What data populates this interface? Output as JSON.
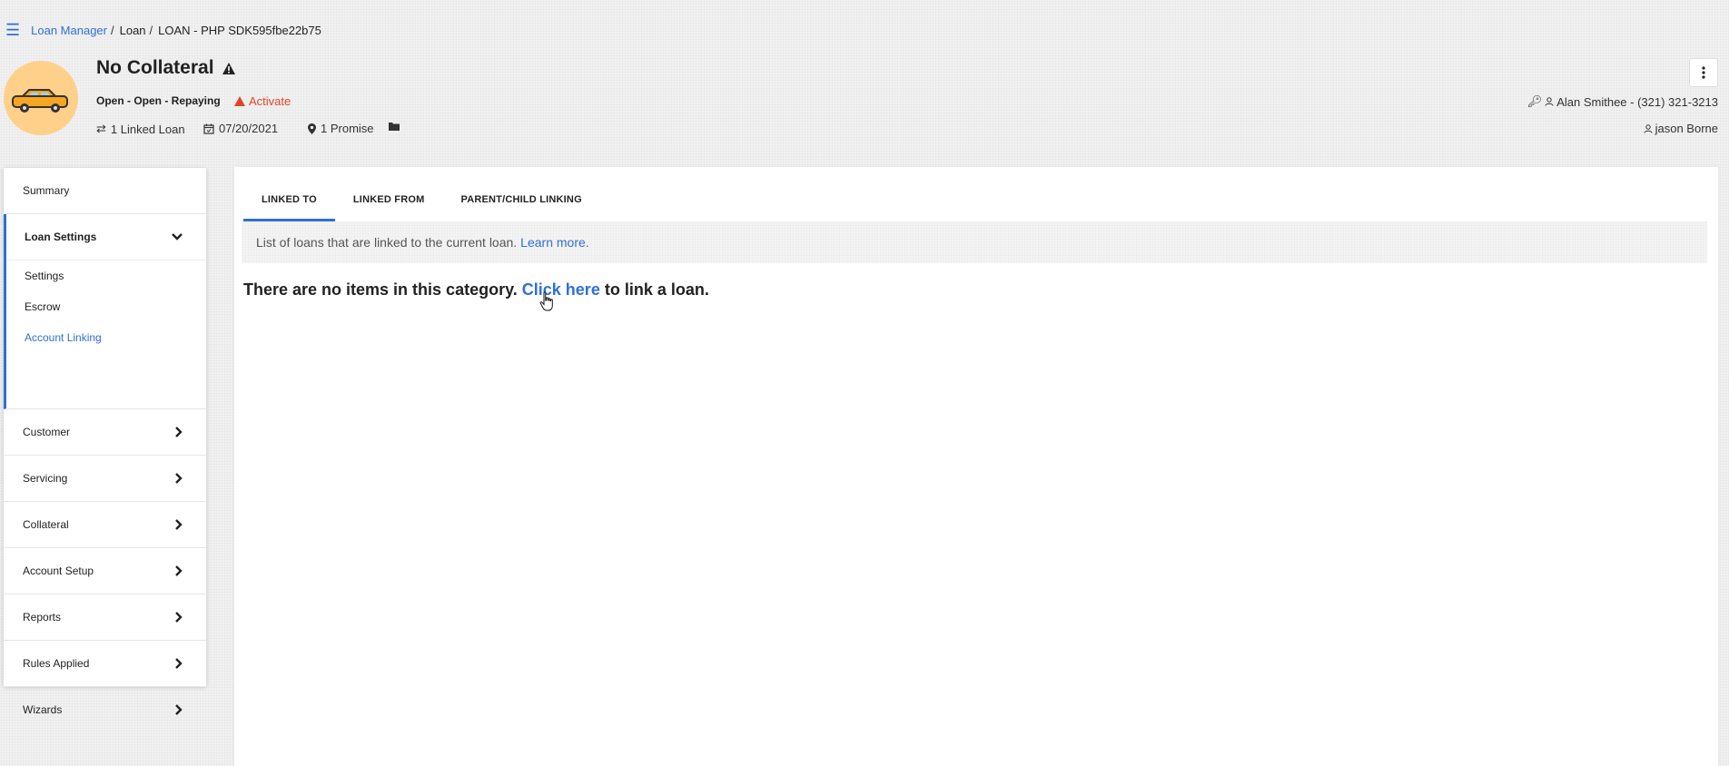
{
  "breadcrumb": {
    "menu_icon": "hamburger-menu-icon",
    "items": [
      "Loan Manager",
      "Loan",
      "LOAN - PHP SDK595fbe22b75"
    ],
    "separator": "/"
  },
  "header": {
    "title": "No Collateral",
    "status": "Open - Open - Repaying",
    "activate_label": "Activate",
    "linked_loan": "1 Linked Loan",
    "date": "07/20/2021",
    "promise": "1 Promise",
    "contact": "Alan Smithee - (321) 321-3213",
    "assignee": "jason Borne"
  },
  "sidebar": {
    "summary": "Summary",
    "loan_settings": {
      "label": "Loan Settings",
      "subitems": [
        "Settings",
        "Escrow",
        "Account Linking"
      ]
    },
    "items": [
      "Customer",
      "Servicing",
      "Collateral",
      "Account Setup",
      "Reports",
      "Rules Applied",
      "Wizards"
    ]
  },
  "tabs": [
    "LINKED TO",
    "LINKED FROM",
    "PARENT/CHILD LINKING"
  ],
  "info": {
    "text": "List of loans that are linked to the current loan.",
    "link": "Learn more."
  },
  "empty_state": {
    "prefix": "There are no items in this category.",
    "link": "Click here",
    "suffix": "to link a loan."
  },
  "colors": {
    "accent": "#2f6fd8",
    "warning": "#e0452b",
    "avatar_bg": "#ffd08a",
    "car_body": "#f5a623"
  }
}
